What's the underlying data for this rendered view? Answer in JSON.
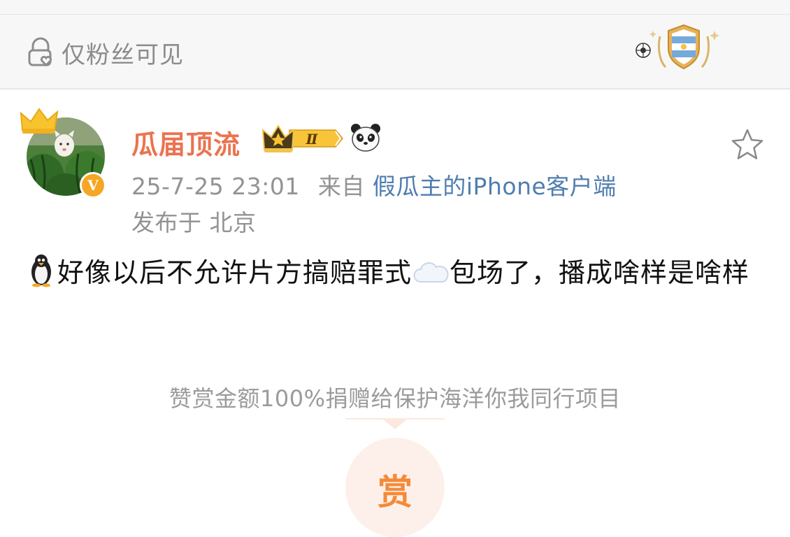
{
  "visibility": {
    "label": "仅粉丝可见"
  },
  "author": {
    "name": "瓜届顶流",
    "badge_text": "Ⅱ"
  },
  "meta": {
    "time": "25-7-25 23:01",
    "source_prefix": "来自",
    "source_client": "假瓜主的iPhone客户端",
    "location": "发布于 北京"
  },
  "post": {
    "text_part1": "好像以后不允许片方搞赔罪式",
    "text_part2": "包场了，播成啥样是啥样"
  },
  "reward": {
    "note": "赞赏金额100%捐赠给保护海洋你我同行项目",
    "button_label": "赏"
  },
  "colors": {
    "author_name": "#eb7350",
    "client_link": "#507daf",
    "reward_accent": "#f58a36",
    "verified_badge": "#f6a623"
  },
  "icons": [
    "lock-heart-icon",
    "football-emblem-icon",
    "crown-icon",
    "verified-v-icon",
    "vip-level-badge-icon",
    "panda-emoji-icon",
    "star-icon",
    "penguin-emoji-icon",
    "cloud-emoji-icon"
  ]
}
